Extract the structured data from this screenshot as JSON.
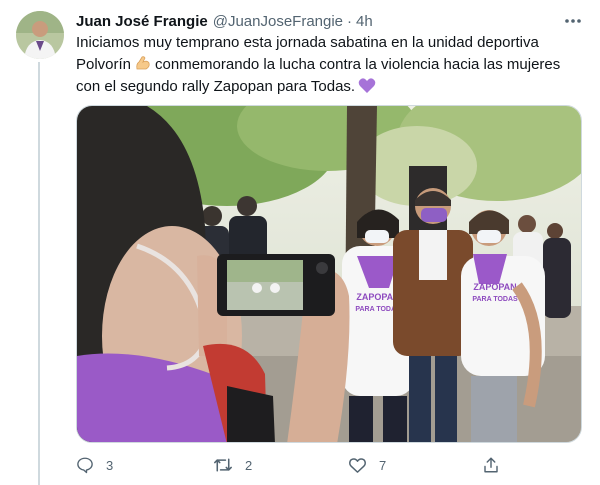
{
  "tweet": {
    "author_name": "Juan José Frangie",
    "author_handle": "@JuanJoseFrangie",
    "separator": "·",
    "time": "4h",
    "text_lines": [
      "Iniciamos muy temprano esta jornada sabatina en la unidad deportiva",
      "Polvorín",
      "conmemorando la lucha contra la violencia hacia las mujeres",
      "con el segundo rally Zapopan para Todas."
    ],
    "emojis": [
      "flexed-biceps-emoji",
      "purple-heart-emoji"
    ],
    "photo_shirt_text": [
      "ZAPOPAN",
      "PARA TODAS"
    ]
  },
  "actions": {
    "replies": "3",
    "retweets": "2",
    "likes": "7"
  },
  "colors": {
    "text_primary": "#0f1419",
    "text_secondary": "#536471",
    "border": "#cfd9de",
    "purple": "#9b59c9"
  },
  "icons": [
    "more-icon",
    "reply-icon",
    "retweet-icon",
    "like-icon",
    "share-icon"
  ]
}
